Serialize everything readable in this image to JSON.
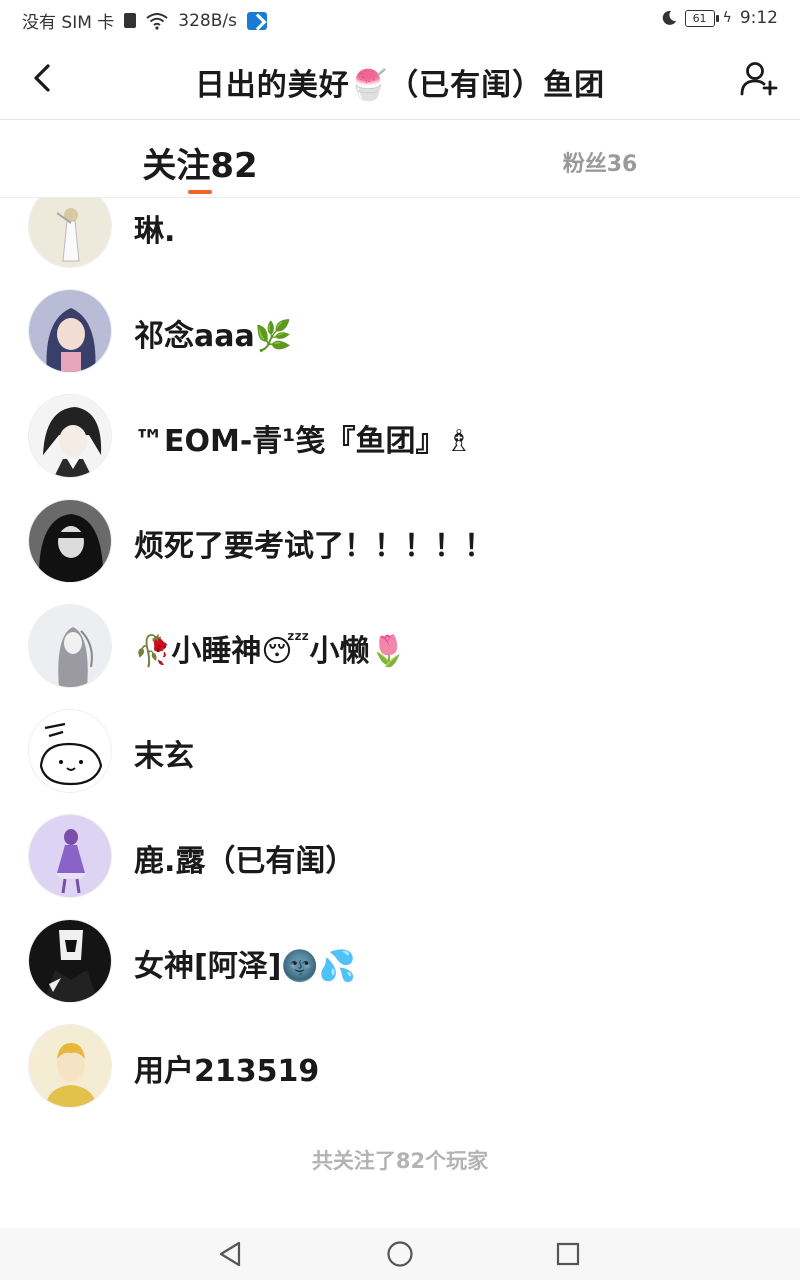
{
  "status_bar": {
    "carrier": "没有 SIM 卡",
    "speed": "328B/s",
    "battery": "61",
    "time": "9:12"
  },
  "header": {
    "title": "日出的美好🍧（已有闺）鱼团",
    "back_icon": "chevron-left-icon",
    "add_icon": "add-user-icon"
  },
  "tabs": {
    "following": "关注82",
    "fans": "粉丝36",
    "active": "following",
    "accent_color": "#f26522"
  },
  "users": [
    {
      "name": "琳."
    },
    {
      "name": "祁念aaa🌿"
    },
    {
      "name": "™EOM-青¹笺『鱼团』♗"
    },
    {
      "name": "烦死了要考试了！！！！！"
    },
    {
      "name": "🥀小睡神😴小懒🌷"
    },
    {
      "name": "末玄"
    },
    {
      "name": "鹿.露（已有闺）"
    },
    {
      "name": "女神[阿泽]🌚💦"
    },
    {
      "name": "用户213519"
    }
  ],
  "footer": {
    "summary": "共关注了82个玩家"
  },
  "nav": {
    "back": "nav-back-icon",
    "home": "nav-home-icon",
    "recent": "nav-recent-icon"
  }
}
